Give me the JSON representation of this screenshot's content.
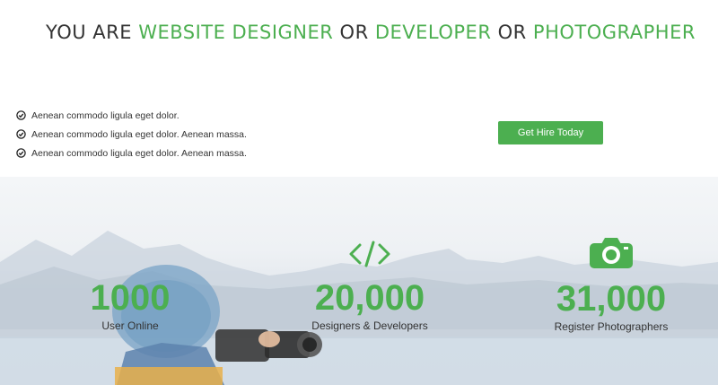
{
  "headline": {
    "part1": "YOU ARE ",
    "highlight1": "WEBSITE DESIGNER",
    "part2": " OR ",
    "highlight2": "DEVELOPER",
    "part3": " OR ",
    "highlight3": "PHOTOGRAPHER"
  },
  "features": [
    "Aenean commodo ligula eget dolor.",
    "Aenean commodo ligula eget dolor. Aenean massa.",
    "Aenean commodo ligula eget dolor. Aenean massa."
  ],
  "cta": {
    "label": "Get Hire Today"
  },
  "stats": [
    {
      "value": "1000",
      "label": "User Online",
      "icon": "none"
    },
    {
      "value": "20,000",
      "label": "Designers & Developers",
      "icon": "code-icon"
    },
    {
      "value": "31,000",
      "label": "Register Photographers",
      "icon": "camera-icon"
    }
  ],
  "colors": {
    "accent": "#4caf50",
    "text": "#333333"
  }
}
